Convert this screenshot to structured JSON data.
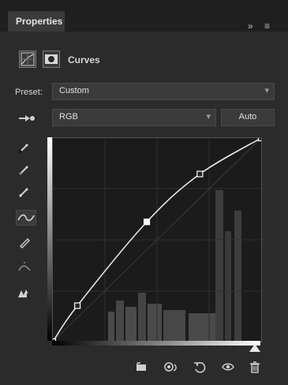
{
  "panel": {
    "tab_label": "Properties",
    "header_controls": {
      "double_chevron": "»",
      "menu_icon": "menu-icon"
    }
  },
  "adjustment": {
    "title": "Curves",
    "icons": [
      "curves-adjustment-icon",
      "mask-icon"
    ]
  },
  "preset": {
    "label": "Preset:",
    "value": "Custom"
  },
  "channel": {
    "value": "RGB",
    "auto_label": "Auto"
  },
  "tools": [
    "on-image-adjust-icon",
    "black-point-eyedropper-icon",
    "gray-point-eyedropper-icon",
    "white-point-eyedropper-icon",
    "curve-point-tool-icon",
    "pencil-tool-icon",
    "smooth-curve-icon",
    "clipping-warning-icon"
  ],
  "curve": {
    "points": [
      {
        "input": 0,
        "output": 0
      },
      {
        "input": 30,
        "output": 45
      },
      {
        "input": 115,
        "output": 150
      },
      {
        "input": 180,
        "output": 210
      },
      {
        "input": 255,
        "output": 255
      }
    ],
    "selected_point_index": 2
  },
  "bottom_toolbar": {
    "icons": [
      "clip-to-layer-icon",
      "view-previous-icon",
      "reset-icon",
      "visibility-icon",
      "trash-icon"
    ]
  }
}
